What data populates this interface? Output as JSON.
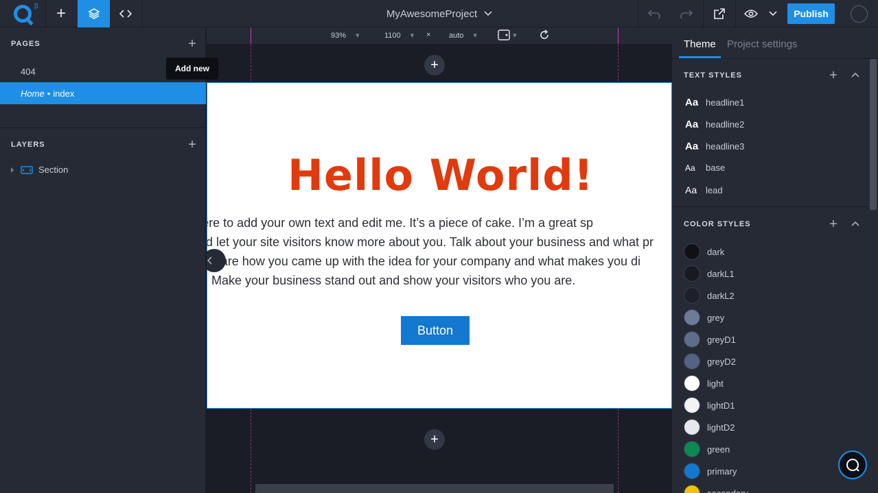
{
  "topbar": {
    "beta": "β",
    "project_title": "MyAwesomeProject",
    "publish_label": "Publish"
  },
  "pages": {
    "heading": "PAGES",
    "add_tooltip": "Add new",
    "items": [
      {
        "label": "404"
      },
      {
        "home": "Home",
        "separator": "•",
        "label": "index",
        "active": true
      }
    ]
  },
  "layers": {
    "heading": "LAYERS",
    "items": [
      {
        "label": "Section"
      }
    ]
  },
  "canvas_toolbar": {
    "zoom": "93%",
    "width": "1100",
    "times": "×",
    "height": "auto"
  },
  "canvas": {
    "headline": "Hello World!",
    "paragraph_lines": [
      "This is a paragraph. Click here to add your own text and edit me. It’s a piece of cake. I’m a great sp",
      "and let your site visitors know more about you. Talk about your business and what pr",
      "offer. Share how you came up with the idea for your company and what makes you di",
      "competitors. Make your business stand out and show your visitors who you are."
    ],
    "button_label": "Button",
    "colors": {
      "headline": "#e03a0e",
      "button": "#1378cf"
    }
  },
  "right_panel": {
    "tabs": [
      "Theme",
      "Project settings"
    ],
    "text_styles": {
      "heading": "TEXT STYLES",
      "items": [
        {
          "icon": "Aa",
          "label": "headline1"
        },
        {
          "icon": "Aa",
          "label": "headline2"
        },
        {
          "icon": "Aa",
          "label": "headline3"
        },
        {
          "icon": "Aa",
          "label": "base"
        },
        {
          "icon": "Aa",
          "label": "lead"
        }
      ]
    },
    "color_styles": {
      "heading": "COLOR STYLES",
      "items": [
        {
          "label": "dark",
          "color": "#0f1116"
        },
        {
          "label": "darkL1",
          "color": "#171a21"
        },
        {
          "label": "darkL2",
          "color": "#1d2029"
        },
        {
          "label": "grey",
          "color": "#6d7b98"
        },
        {
          "label": "greyD1",
          "color": "#5f6d8c"
        },
        {
          "label": "greyD2",
          "color": "#546382"
        },
        {
          "label": "light",
          "color": "#ffffff"
        },
        {
          "label": "lightD1",
          "color": "#f2f3f5"
        },
        {
          "label": "lightD2",
          "color": "#e6e8ec"
        },
        {
          "label": "green",
          "color": "#0b8a56"
        },
        {
          "label": "primary",
          "color": "#1378cf"
        },
        {
          "label": "secondary",
          "color": "#f2c200"
        }
      ]
    }
  }
}
